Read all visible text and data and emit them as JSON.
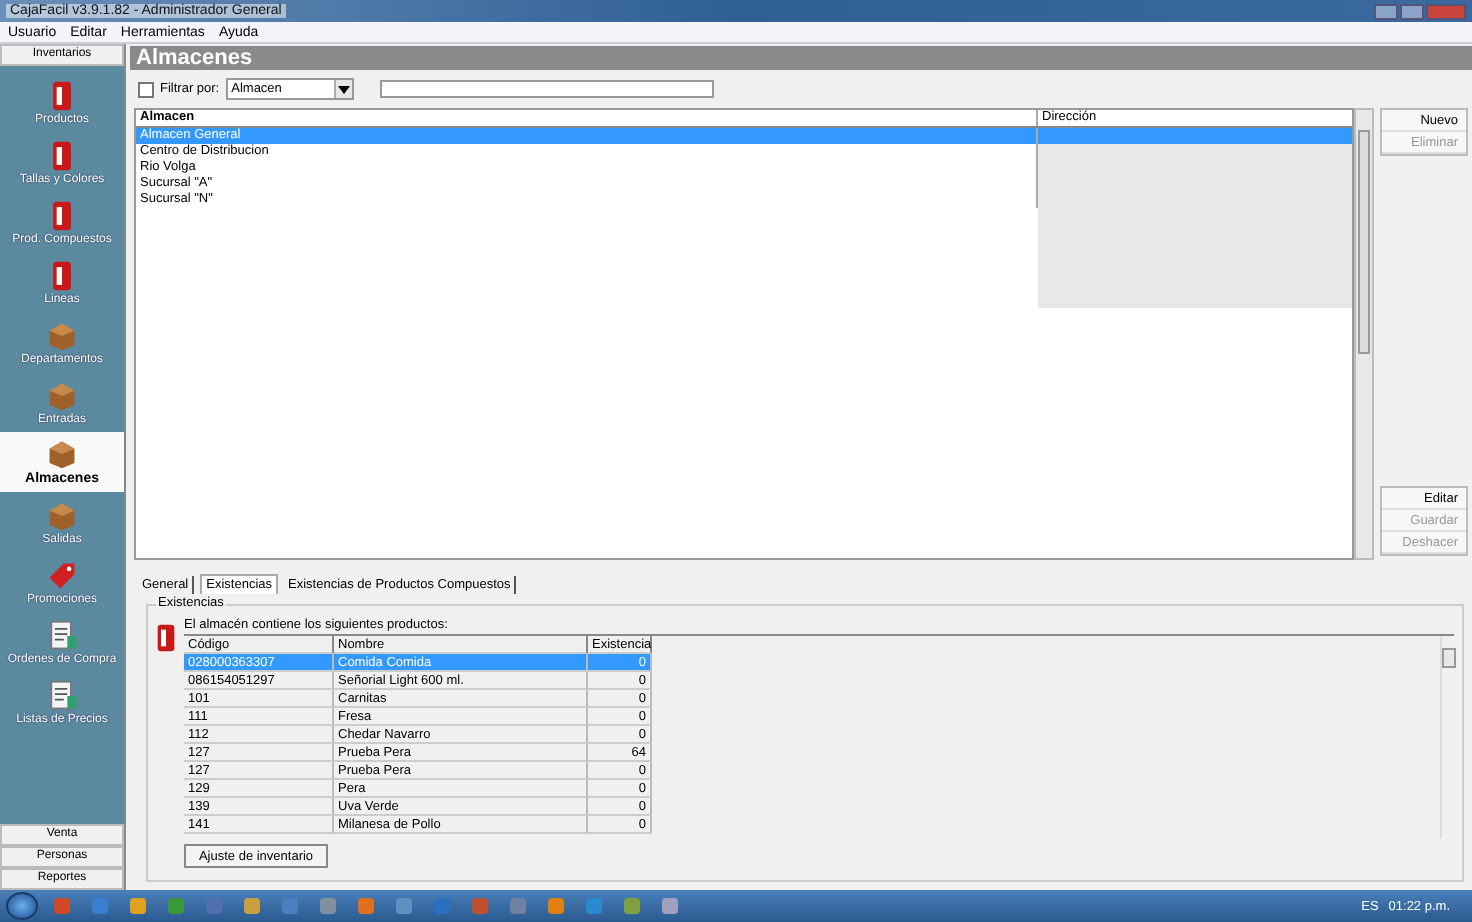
{
  "window": {
    "title": "CajaFacil v3.9.1.82 - Administrador General"
  },
  "menu": [
    "Usuario",
    "Editar",
    "Herramientas",
    "Ayuda"
  ],
  "sidebar": {
    "section": "Inventarios",
    "items": [
      {
        "label": "Productos",
        "selected": false
      },
      {
        "label": "Tallas y Colores",
        "selected": false
      },
      {
        "label": "Prod. Compuestos",
        "selected": false
      },
      {
        "label": "Lineas",
        "selected": false
      },
      {
        "label": "Departamentos",
        "selected": false
      },
      {
        "label": "Entradas",
        "selected": false
      },
      {
        "label": "Almacenes",
        "selected": true
      },
      {
        "label": "Salidas",
        "selected": false
      },
      {
        "label": "Promociones",
        "selected": false
      },
      {
        "label": "Ordenes de Compra",
        "selected": false
      },
      {
        "label": "Listas de Precios",
        "selected": false
      }
    ],
    "bottom": [
      "Venta",
      "Personas",
      "Reportes"
    ]
  },
  "header": "Almacenes",
  "filter": {
    "label": "Filtrar por:",
    "checked": false,
    "dropdown": "Almacen"
  },
  "list": {
    "columns": [
      "Almacen",
      "Dirección"
    ],
    "rows": [
      {
        "name": "Almacen General",
        "selected": true
      },
      {
        "name": "Centro de Distribucion",
        "selected": false
      },
      {
        "name": "Rio Volga",
        "selected": false
      },
      {
        "name": "Sucursal \"A\"",
        "selected": false
      },
      {
        "name": "Sucursal \"N\"",
        "selected": false
      }
    ]
  },
  "actions": [
    {
      "label": "Nuevo",
      "disabled": false
    },
    {
      "label": "Eliminar",
      "disabled": true
    }
  ],
  "edit_actions": [
    {
      "label": "Editar",
      "disabled": false
    },
    {
      "label": "Guardar",
      "disabled": true
    },
    {
      "label": "Deshacer",
      "disabled": true
    }
  ],
  "tabs": [
    {
      "label": "General",
      "selected": false
    },
    {
      "label": "Existencias",
      "selected": true
    },
    {
      "label": "Existencias de Productos Compuestos",
      "selected": false
    }
  ],
  "stock": {
    "title": "Existencias",
    "caption": "El almacén contiene los siguientes productos:",
    "columns": [
      "Código",
      "Nombre",
      "Existencia"
    ],
    "rows": [
      {
        "cells": [
          "028000363307",
          "Comida Comida",
          "0"
        ],
        "selected": true
      },
      {
        "cells": [
          "086154051297",
          "Señorial Light 600 ml.",
          "0"
        ],
        "selected": false
      },
      {
        "cells": [
          "101",
          "Carnitas",
          "0"
        ],
        "selected": false
      },
      {
        "cells": [
          "111",
          "Fresa",
          "0"
        ],
        "selected": false
      },
      {
        "cells": [
          "112",
          "Chedar Navarro",
          "0"
        ],
        "selected": false
      },
      {
        "cells": [
          "127",
          "Prueba Pera",
          "64"
        ],
        "selected": false
      },
      {
        "cells": [
          "127",
          "Prueba Pera",
          "0"
        ],
        "selected": false
      },
      {
        "cells": [
          "129",
          "Pera",
          "0"
        ],
        "selected": false
      },
      {
        "cells": [
          "139",
          "Uva Verde",
          "0"
        ],
        "selected": false
      },
      {
        "cells": [
          "141",
          "Milanesa de Pollo",
          "0"
        ],
        "selected": false
      }
    ],
    "button": "Ajuste de inventario"
  },
  "taskbar": {
    "language": "ES",
    "clock": "01:22 p.m."
  }
}
